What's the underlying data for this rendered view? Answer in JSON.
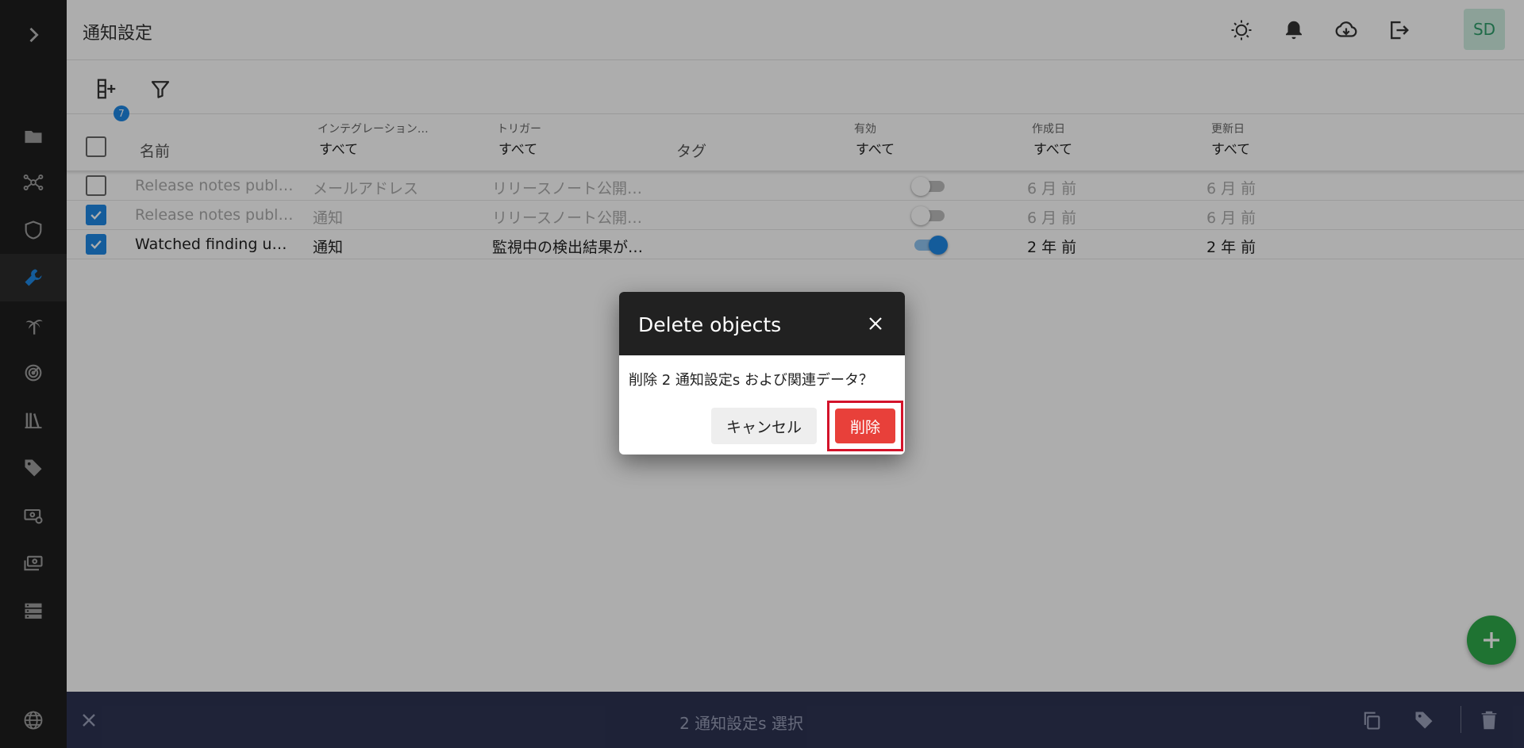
{
  "page": {
    "title": "通知設定"
  },
  "user": {
    "initials": "SD"
  },
  "toolbar": {
    "columns_badge": "7"
  },
  "table": {
    "headers": {
      "name": "名前",
      "integration": {
        "label": "インテグレーション…",
        "filter": "すべて"
      },
      "trigger": {
        "label": "トリガー",
        "filter": "すべて"
      },
      "tags": "タグ",
      "enabled": {
        "label": "有効",
        "filter": "すべて"
      },
      "created": {
        "label": "作成日",
        "filter": "すべて"
      },
      "updated": {
        "label": "更新日",
        "filter": "すべて"
      }
    },
    "rows": [
      {
        "name": "Release notes publis…",
        "integration": "メールアドレス",
        "trigger": "リリースノート公開…",
        "enabled": false,
        "created": "6 月 前",
        "updated": "6 月 前",
        "checked": false,
        "disabled": true
      },
      {
        "name": "Release notes publis…",
        "integration": "通知",
        "trigger": "リリースノート公開…",
        "enabled": false,
        "created": "6 月 前",
        "updated": "6 月 前",
        "checked": true,
        "disabled": true
      },
      {
        "name": "Watched finding upd…",
        "integration": "通知",
        "trigger": "監視中の検出結果が…",
        "enabled": true,
        "created": "2 年 前",
        "updated": "2 年 前",
        "checked": true,
        "disabled": false
      }
    ]
  },
  "selection_bar": {
    "text": "2 通知設定s 選択"
  },
  "dialog": {
    "title": "Delete objects",
    "message": "削除 2 通知設定s および関連データ？",
    "cancel_label": "キャンセル",
    "delete_label": "削除"
  },
  "colors": {
    "accent": "#1e88e5",
    "danger": "#e8403a",
    "fab": "#2eaa4a",
    "sidebar": "#1e1e1e",
    "bottombar": "#2d3352"
  }
}
